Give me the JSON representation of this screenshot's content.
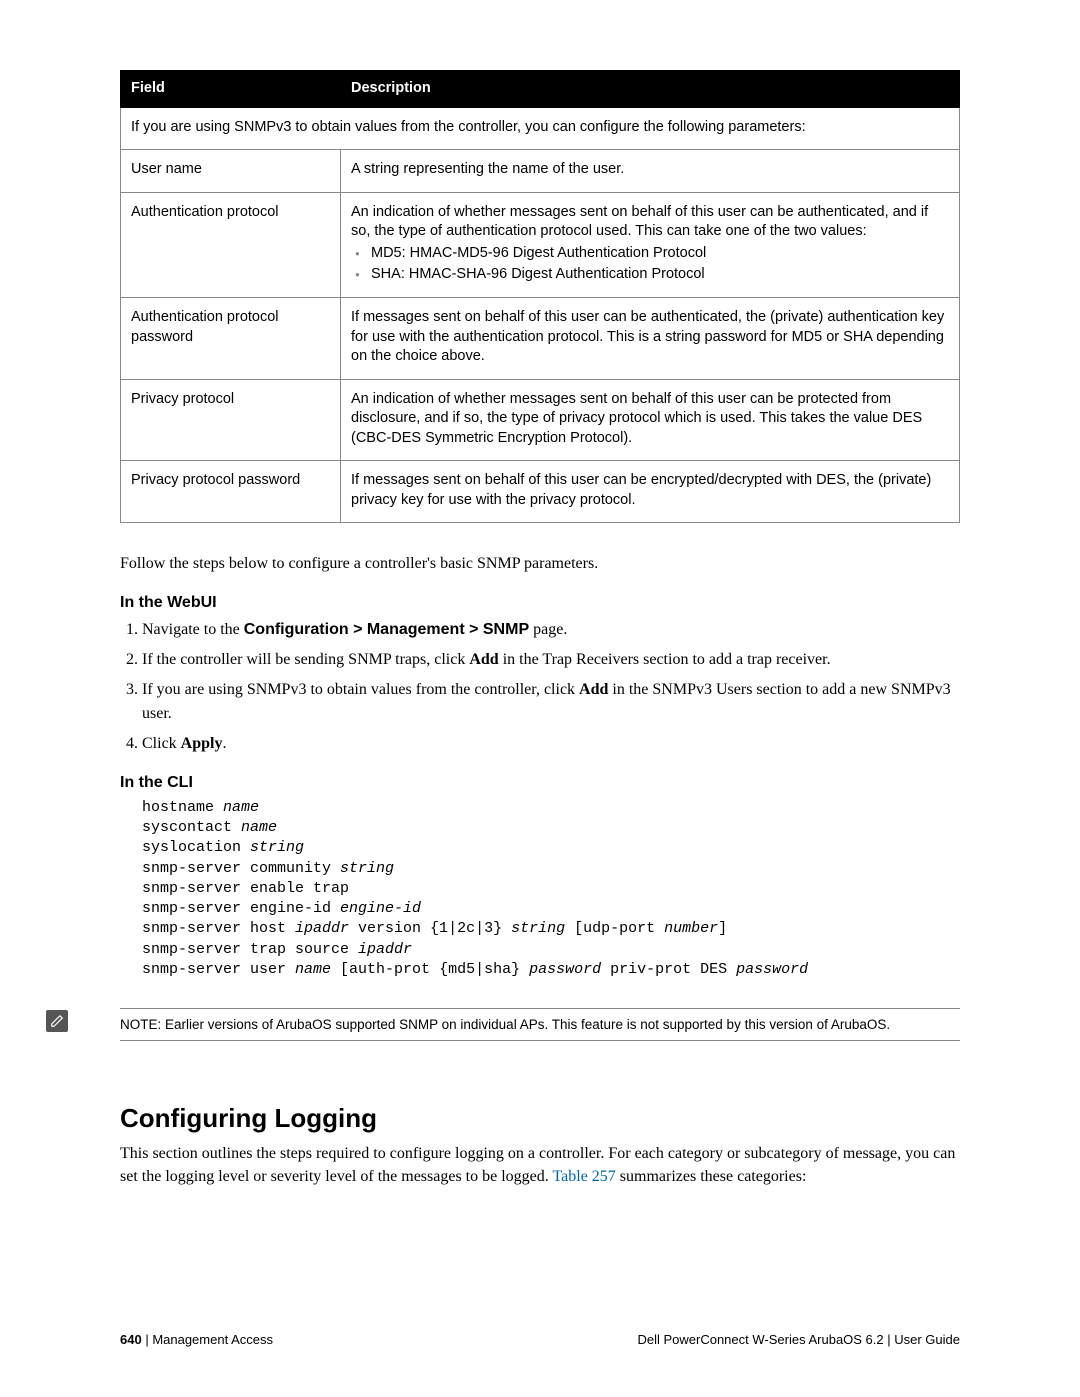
{
  "table": {
    "headers": {
      "field": "Field",
      "description": "Description"
    },
    "intro": "If you are using SNMPv3 to obtain values from the controller, you can configure the following parameters:",
    "rows": {
      "r1": {
        "field": "User name",
        "desc": "A string representing the name of the user."
      },
      "r2": {
        "field": "Authentication protocol",
        "desc": "An indication of whether messages sent on behalf of this user can be authenticated, and if so, the type of authentication protocol used. This can take one of the two values:",
        "b1": "MD5: HMAC-MD5-96 Digest Authentication Protocol",
        "b2": "SHA: HMAC-SHA-96 Digest Authentication Protocol"
      },
      "r3": {
        "field": "Authentication protocol password",
        "desc": "If messages sent on behalf of this user can be authenticated, the (private) authentication key for use with the authentication protocol. This is a string password for MD5 or SHA depending on the choice above."
      },
      "r4": {
        "field": "Privacy protocol",
        "desc": "An indication of whether messages sent on behalf of this user can be protected from disclosure, and if so, the type of privacy protocol which is used. This takes the value DES (CBC-DES Symmetric Encryption Protocol)."
      },
      "r5": {
        "field": "Privacy protocol password",
        "desc": "If messages sent on behalf of this user can be encrypted/decrypted with DES, the (private) privacy key for use with the privacy protocol."
      }
    }
  },
  "followText": "Follow the steps below to configure a controller's basic SNMP parameters.",
  "webui": {
    "heading": "In the WebUI",
    "s1_pre": "Navigate to the ",
    "s1_bold": "Configuration > Management > SNMP",
    "s1_post": " page.",
    "s2_a": "If the controller will be sending SNMP traps, click ",
    "s2_b": "Add",
    "s2_c": " in the Trap Receivers section to add a trap receiver.",
    "s3_a": "If you are using SNMPv3 to obtain values from the controller, click ",
    "s3_b": "Add",
    "s3_c": " in the SNMPv3 Users section to add a new SNMPv3 user.",
    "s4_a": "Click ",
    "s4_b": "Apply",
    "s4_c": "."
  },
  "cli": {
    "heading": "In the CLI",
    "l1a": "hostname ",
    "l1b": "name",
    "l2a": "syscontact ",
    "l2b": "name",
    "l3a": "syslocation ",
    "l3b": "string",
    "l4a": "snmp-server community ",
    "l4b": "string",
    "l5": "snmp-server enable trap",
    "l6a": "snmp-server engine-id ",
    "l6b": "engine-id",
    "l7a": "snmp-server host ",
    "l7b": "ipaddr",
    "l7c": " version {1|2c|3} ",
    "l7d": "string",
    "l7e": " [udp-port ",
    "l7f": "number",
    "l7g": "]",
    "l8a": "snmp-server trap source ",
    "l8b": "ipaddr",
    "l9a": "snmp-server user ",
    "l9b": "name",
    "l9c": " [auth-prot {md5|sha} ",
    "l9d": "password",
    "l9e": " priv-prot DES ",
    "l9f": "password"
  },
  "note": "NOTE: Earlier versions of ArubaOS supported SNMP on individual APs. This feature is not supported by this version of ArubaOS.",
  "section2": {
    "heading": "Configuring Logging",
    "body_a": "This section outlines the steps required to configure logging on a controller. For each category or subcategory of message, you can set the logging level or severity level of the messages to be logged. ",
    "link": "Table 257",
    "body_b": " summarizes these categories:"
  },
  "footer": {
    "page": "640",
    "sep": " | ",
    "left": "Management Access",
    "right_a": "Dell PowerConnect W-Series ArubaOS 6.2",
    "right_sep": "  |  ",
    "right_b": "User Guide"
  }
}
